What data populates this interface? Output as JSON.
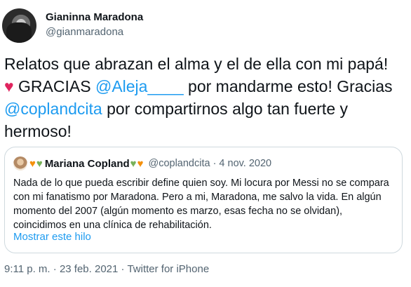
{
  "author": {
    "name": "Gianinna Maradona",
    "handle": "@gianmaradona"
  },
  "tweet": {
    "text_1": "Relatos que abrazan el alma y el de ella con mi papá!",
    "heart": "♥",
    "text_2": " GRACIAS ",
    "mention_1": "@Aleja____",
    "text_3": " por mandarme esto! Gracias ",
    "mention_2": "@coplandcita",
    "text_4": " por compartirnos algo tan fuerte y hermoso!"
  },
  "quote": {
    "heart_orange": "♥",
    "heart_green": "♥",
    "name": "Mariana Copland",
    "handle": "@coplandcita",
    "separator": "·",
    "date": "4 nov. 2020",
    "text": "Nada de lo que pueda escribir define quien soy. Mi locura por Messi no se compara con mi fanatismo por Maradona. Pero a mi, Maradona, me salvo la vida. En algún momento del 2007 (algún momento es marzo, esas fecha no se olvidan), coincidimos en una clínica de rehabilitación.",
    "show_thread": "Mostrar este hilo"
  },
  "meta": {
    "time": "9:11 p. m.",
    "separator": "·",
    "date": "23 feb. 2021",
    "source": "Twitter for iPhone"
  },
  "colors": {
    "link": "#1d9bf0",
    "secondary_text": "#536471",
    "heart_red": "#e0245e",
    "heart_orange": "#f4900c",
    "heart_green": "#78b159"
  },
  "icons": {
    "avatar": "profile-photo",
    "quote_avatar": "profile-photo"
  }
}
